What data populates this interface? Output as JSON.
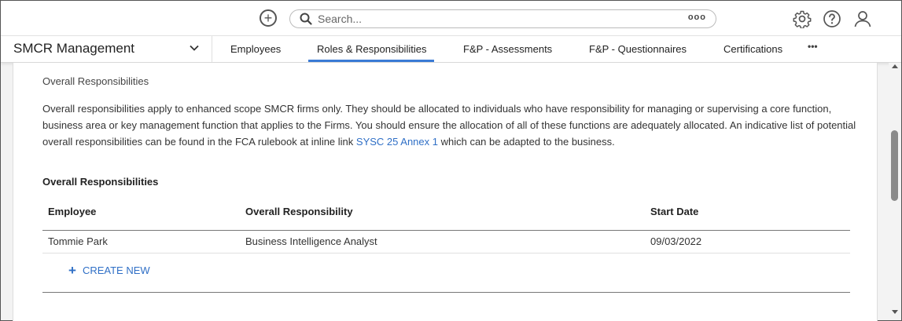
{
  "topbar": {
    "search_placeholder": "Search...",
    "search_options_label": "ooo",
    "icons": [
      "add-icon",
      "search-icon",
      "settings-icon",
      "help-icon",
      "user-icon"
    ]
  },
  "nav": {
    "app_title": "SMCR Management",
    "tabs": [
      {
        "label": "Employees"
      },
      {
        "label": "Roles & Responsibilities",
        "active": true
      },
      {
        "label": "F&P - Assessments"
      },
      {
        "label": "F&P - Questionnaires"
      },
      {
        "label": "Certifications"
      }
    ],
    "more_label": "•••"
  },
  "section": {
    "title": "Overall Responsibilities",
    "description_before": "Overall responsibilities apply to enhanced scope SMCR firms only. They should be allocated to individuals who have responsibility for managing or supervising a core function, business area or key management function that applies to the Firms. You should ensure the allocation of all of these functions are adequately allocated. An indicative list of potential overall responsibilities can be found in the FCA rulebook at inline link ",
    "link_text": "SYSC 25 Annex 1",
    "description_after": " which can be adapted to the business."
  },
  "table": {
    "title": "Overall Responsibilities",
    "columns": [
      "Employee",
      "Overall Responsibility",
      "Start Date"
    ],
    "rows": [
      [
        "Tommie Park",
        "Business Intelligence Analyst",
        "09/03/2022"
      ]
    ],
    "create_label": "CREATE NEW"
  },
  "colors": {
    "accent": "#3a7bd5",
    "link": "#2f6fc6"
  }
}
